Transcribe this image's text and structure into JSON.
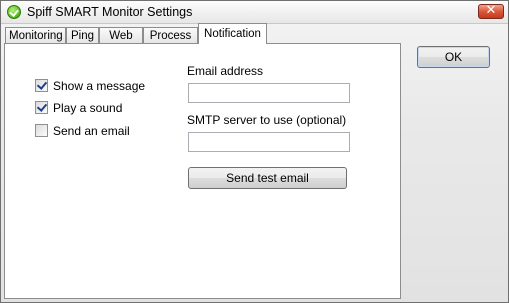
{
  "window": {
    "title": "Spiff SMART Monitor Settings",
    "close_glyph": "✕",
    "icon": "green-check-icon"
  },
  "tabs": [
    {
      "label": "Monitoring",
      "active": false
    },
    {
      "label": "Ping",
      "active": false
    },
    {
      "label": "Web",
      "active": false
    },
    {
      "label": "Process",
      "active": false
    },
    {
      "label": "Notification",
      "active": true
    }
  ],
  "notification": {
    "options": [
      {
        "label": "Show a message",
        "checked": true
      },
      {
        "label": "Play a sound",
        "checked": true
      },
      {
        "label": "Send an email",
        "checked": false
      }
    ],
    "email": {
      "label": "Email address",
      "value": ""
    },
    "smtp": {
      "label": "SMTP server to use (optional)",
      "value": ""
    },
    "test_button": "Send test email"
  },
  "buttons": {
    "ok": "OK"
  },
  "colors": {
    "close_button": "#d9583c",
    "app_icon": "#4fb71a",
    "check_mark": "#1f3f8a"
  }
}
